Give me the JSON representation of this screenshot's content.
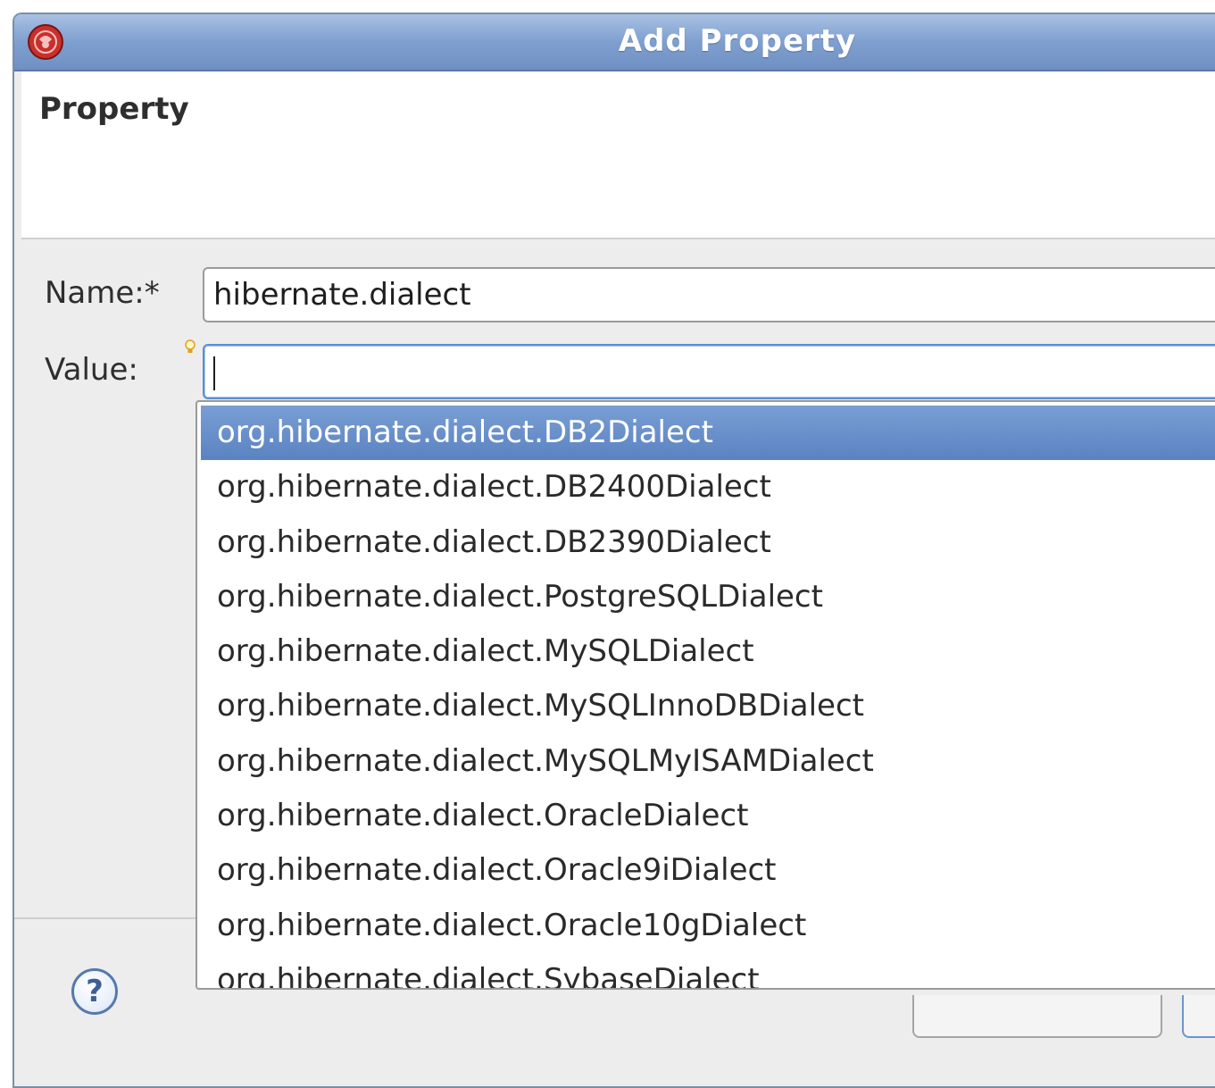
{
  "window": {
    "title": "Add Property"
  },
  "header": {
    "title": "Property"
  },
  "form": {
    "name_label": "Name:*",
    "name_value": "hibernate.dialect",
    "value_label": "Value:",
    "value_value": ""
  },
  "content_assist": {
    "selected_index": 0,
    "items": [
      "org.hibernate.dialect.DB2Dialect",
      "org.hibernate.dialect.DB2400Dialect",
      "org.hibernate.dialect.DB2390Dialect",
      "org.hibernate.dialect.PostgreSQLDialect",
      "org.hibernate.dialect.MySQLDialect",
      "org.hibernate.dialect.MySQLInnoDBDialect",
      "org.hibernate.dialect.MySQLMyISAMDialect",
      "org.hibernate.dialect.OracleDialect",
      "org.hibernate.dialect.Oracle9iDialect",
      "org.hibernate.dialect.Oracle10gDialect",
      "org.hibernate.dialect.SybaseDialect"
    ]
  },
  "footer": {
    "help_glyph": "?"
  },
  "icons": {
    "app": "eclipse-app-icon",
    "hint": "lightbulb-icon",
    "help": "help-icon"
  },
  "colors": {
    "titlebar": "#7f9fcf",
    "selection": "#5a83c2",
    "focus_border": "#5b8ed6"
  }
}
